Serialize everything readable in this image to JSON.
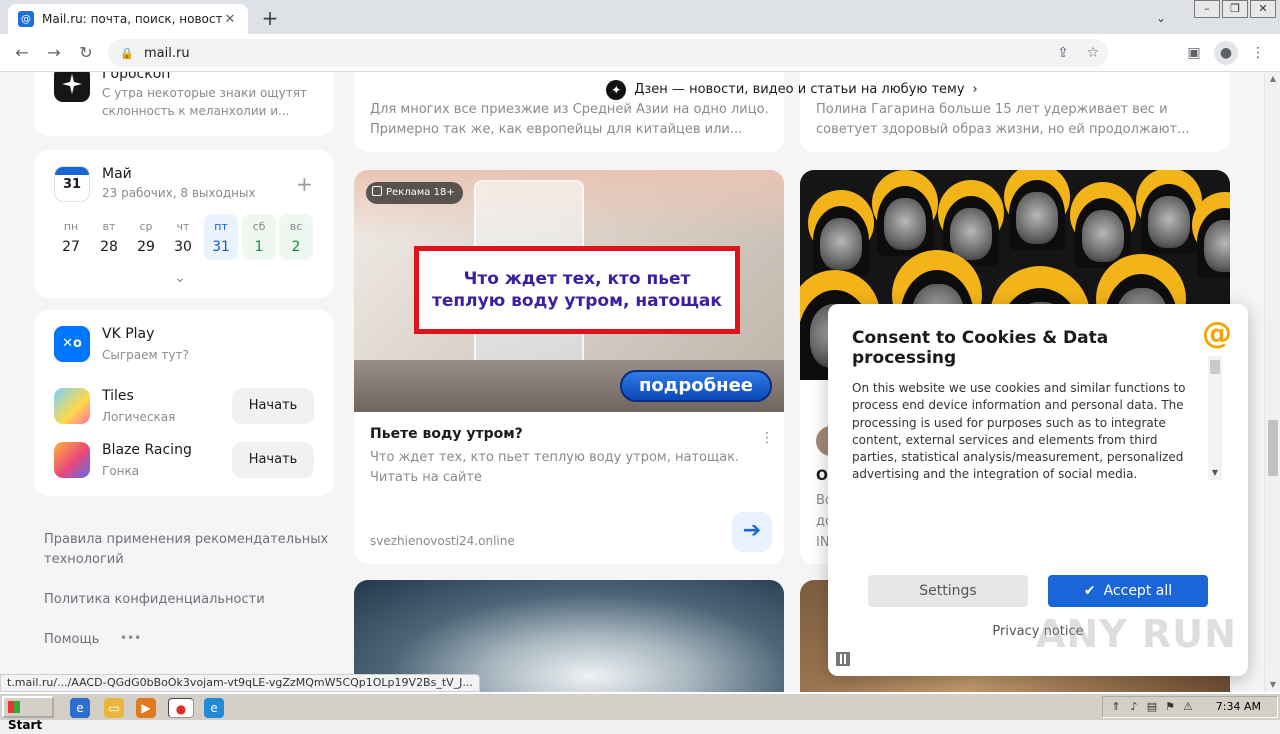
{
  "browser": {
    "tab_title": "Mail.ru: почта, поиск, новости, пр",
    "tab_close": "✕",
    "new_tab": "+",
    "url": "mail.ru",
    "status_url": "t.mail.ru/.../AACD-QGdG0bBoOk3vojam-vt9qLE-vgZzMQmW5CQp1OLp19V2Bs_tV_J..."
  },
  "sidebar": {
    "horoscope": {
      "title": "Гороскоп",
      "text": "С утра некоторые знаки ощутят склонность к меланхолии и..."
    },
    "calendar": {
      "icon_day": "31",
      "month": "Май",
      "summary": "23 рабочих, 8 выходных",
      "days": [
        {
          "name": "пн",
          "num": "27"
        },
        {
          "name": "вт",
          "num": "28"
        },
        {
          "name": "ср",
          "num": "29"
        },
        {
          "name": "чт",
          "num": "30"
        },
        {
          "name": "пт",
          "num": "31"
        },
        {
          "name": "сб",
          "num": "1"
        },
        {
          "name": "вс",
          "num": "2"
        }
      ]
    },
    "games": {
      "title": "VK Play",
      "subtitle": "Сыграем тут?",
      "items": [
        {
          "name": "Tiles",
          "genre": "Логическая",
          "button": "Начать"
        },
        {
          "name": "Blaze Racing",
          "genre": "Гонка",
          "button": "Начать"
        }
      ]
    },
    "footer": {
      "rules": "Правила применения рекомендательных технологий",
      "privacy": "Политика конфиденциальности",
      "help": "Помощь",
      "more": "•••"
    }
  },
  "feed": {
    "dzen_bar": "Дзен — новости, видео и статьи на любую тему",
    "top_left_text": "Для многих все приезжие из Средней Азии на одно лицо. Примерно так же, как европейцы для китайцев или...",
    "top_right_text": "Полина Гагарина больше 15 лет удерживает вес и советует здоровый образ жизни, но ей продолжают...",
    "ad": {
      "badge": "Реклама 18+",
      "headline": "Что ждет тех, кто пьет теплую воду утром, натощак",
      "more_button": "подробнее",
      "title": "Пьете воду утром?",
      "text": "Что ждет тех, кто пьет теплую воду утром, натощак. Читать на сайте",
      "source": "svezhienovosti24.online"
    },
    "right_card_partial": {
      "title_fragment": "О",
      "text_fragment": "Во до IN"
    }
  },
  "consent": {
    "title": "Consent to Cookies & Data processing",
    "logo": "@",
    "body": "On this website we use cookies and similar functions to process end device information and personal data. The processing is used for purposes such as to integrate content, external services and elements from third parties, statistical analysis/measurement, personalized advertising and the integration of social media. Depending",
    "settings": "Settings",
    "accept": "Accept all",
    "privacy": "Privacy notice"
  },
  "watermark": "ANY RUN",
  "taskbar": {
    "start": "Start",
    "time": "7:34 AM"
  },
  "colors": {
    "accent": "#1a66d9",
    "consent_logo": "#f5a300",
    "ad_border": "#e0121b",
    "calendar_today": "#0d5fd1"
  }
}
